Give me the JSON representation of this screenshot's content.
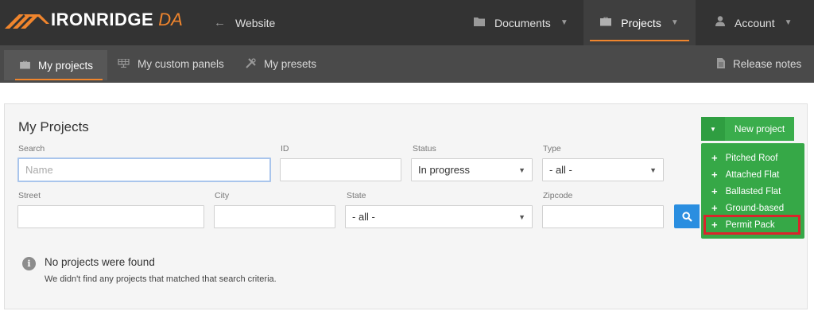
{
  "app": {
    "brand": "IRONRIDGE",
    "brand_suffix": "DA",
    "brand_accent": "#f0852d"
  },
  "topnav": {
    "website": {
      "label": "Website",
      "icon": "arrow-left-icon"
    },
    "documents": {
      "label": "Documents",
      "icon": "folder-icon"
    },
    "projects": {
      "label": "Projects",
      "icon": "briefcase-icon",
      "active": true
    },
    "account": {
      "label": "Account",
      "icon": "user-icon"
    }
  },
  "subnav": {
    "my_projects": {
      "label": "My projects",
      "icon": "briefcase-icon",
      "active": true
    },
    "my_custom_panels": {
      "label": "My custom panels",
      "icon": "solar-panel-icon"
    },
    "my_presets": {
      "label": "My presets",
      "icon": "tools-icon"
    },
    "release_notes": {
      "label": "Release notes",
      "icon": "document-icon"
    }
  },
  "panel": {
    "title": "My Projects"
  },
  "filters": {
    "search": {
      "label": "Search",
      "placeholder": "Name",
      "value": ""
    },
    "id": {
      "label": "ID",
      "value": ""
    },
    "status": {
      "label": "Status",
      "value": "In progress"
    },
    "type": {
      "label": "Type",
      "value": "- all -"
    },
    "street": {
      "label": "Street",
      "value": ""
    },
    "city": {
      "label": "City",
      "value": ""
    },
    "state": {
      "label": "State",
      "value": "- all -"
    },
    "zipcode": {
      "label": "Zipcode",
      "value": ""
    }
  },
  "notice": {
    "title": "No projects were found",
    "message": "We didn't find any projects that matched that search criteria."
  },
  "new_project": {
    "label": "New project",
    "color": "#3aad4c",
    "menu": [
      {
        "label": "Pitched Roof"
      },
      {
        "label": "Attached Flat"
      },
      {
        "label": "Ballasted Flat"
      },
      {
        "label": "Ground-based"
      },
      {
        "label": "Permit Pack",
        "highlighted": true
      }
    ]
  }
}
